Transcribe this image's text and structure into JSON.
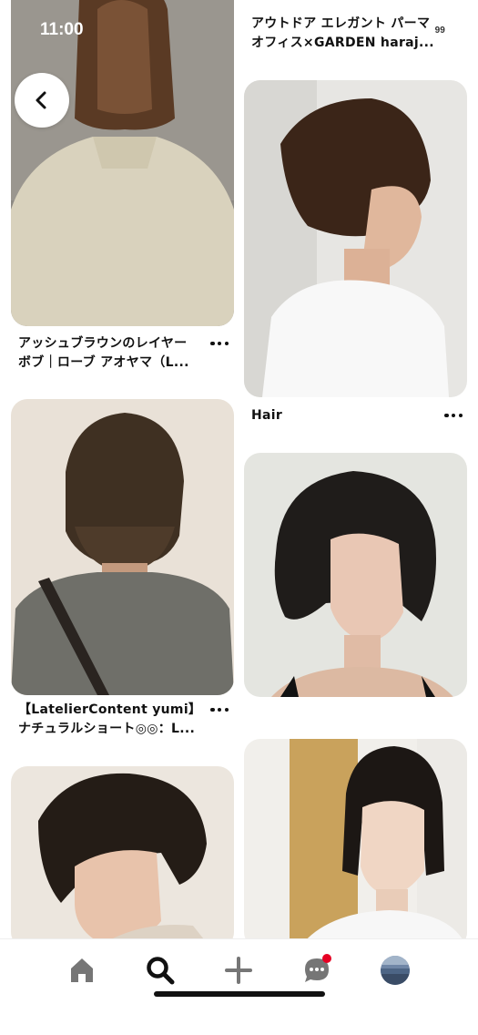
{
  "status_bar": {
    "time": "11:00",
    "battery": "99"
  },
  "pins": [
    {
      "caption_lines": [
        "アウトドア エレガント パーマ",
        "オフィス×GARDEN haraj..."
      ]
    },
    {
      "caption_lines": [
        "アッシュブラウンのレイヤー",
        "ボブ｜ローブ アオヤマ（L..."
      ]
    },
    {
      "caption_lines": [
        "Hair"
      ]
    },
    {
      "caption_lines": [
        "【LatelierContent yumi】",
        "ナチュラルショート◎◎：L..."
      ]
    }
  ],
  "tab_bar": {
    "items": [
      {
        "icon": "home-icon"
      },
      {
        "icon": "search-icon",
        "active": true
      },
      {
        "icon": "plus-icon"
      },
      {
        "icon": "chat-icon",
        "badge": true
      },
      {
        "icon": "profile-avatar"
      }
    ]
  },
  "colors": {
    "accent": "#e60023",
    "text": "#111111",
    "background": "#ffffff"
  }
}
